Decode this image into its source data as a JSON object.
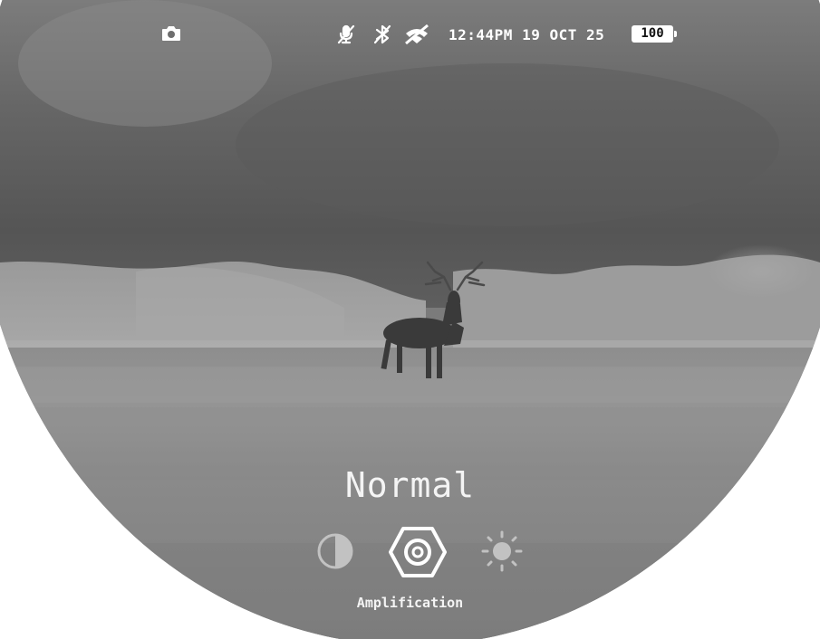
{
  "status_bar": {
    "camera_icon": "camera-icon",
    "icons": [
      "mic-muted-icon",
      "bluetooth-off-icon",
      "wifi-off-icon"
    ],
    "time": "12:44PM",
    "date": "19 OCT 25",
    "battery_level": "100"
  },
  "menu": {
    "title": "Normal",
    "caption": "Amplification",
    "modes": [
      {
        "icon": "contrast-icon",
        "selected": false
      },
      {
        "icon": "amplification-hexagon-icon",
        "selected": true
      },
      {
        "icon": "brightness-sun-icon",
        "selected": false
      }
    ]
  },
  "colors": {
    "scene_gray": "#7b7b7b",
    "sky_dark": "#585858",
    "foreground": "#ffffff"
  }
}
